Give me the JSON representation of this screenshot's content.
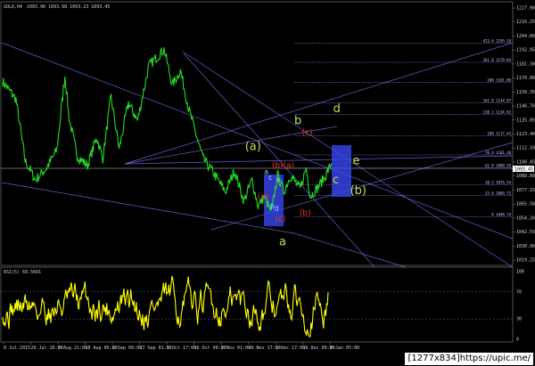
{
  "window": {
    "symbol_label": "GOLD,H4",
    "ohlc": "1093.90 1093.98 1093.23 1093.45",
    "indicator_label": "RSI(5) 69.5601"
  },
  "colors": {
    "background": "#000000",
    "price": "#22dd22",
    "rsi": "#ffff00",
    "trendline": "#7777ff",
    "fib": "#8888ff",
    "zone": "#3b4bff",
    "wave_green": "#b8e05a",
    "wave_red": "#ff3322",
    "wave_cyan": "#88ddff"
  },
  "chart_data": {
    "type": "line",
    "main": {
      "series_label": "GOLD,H4",
      "ylim": [
        1011.0,
        1227.0
      ],
      "price_ticks": [
        "1227.90",
        "1216.25",
        "1204.60",
        "1192.95",
        "1181.30",
        "1170.00",
        "1158.35",
        "1146.70",
        "1135.05",
        "1123.40",
        "1112.10",
        "1100.45",
        "1088.80",
        "1077.15",
        "1065.50",
        "1054.20",
        "1042.55",
        "1030.90",
        "1019.25"
      ],
      "current_price": "1093.45",
      "x_ticks": [
        "8 Jul 2015",
        "20 Jul 16:00",
        "3 Aug 21:00",
        "18 Aug 05:00",
        "2 Sep 09:00",
        "17 Sep 01:00",
        "1 Oct 17:00",
        "16 Oct 09:00",
        "2 Nov 01:00",
        "16 Nov 17:00",
        "1 Dec 17:00",
        "16 Dec 09:00",
        "4 Jan 05:00"
      ],
      "price_anchors": [
        [
          0,
          1163
        ],
        [
          1.3,
          1148
        ],
        [
          2.2,
          1096
        ],
        [
          3.2,
          1080
        ],
        [
          4.3,
          1090
        ],
        [
          5.3,
          1105
        ],
        [
          6.1,
          1168
        ],
        [
          6.5,
          1132
        ],
        [
          7.3,
          1100
        ],
        [
          8.3,
          1092
        ],
        [
          9.2,
          1116
        ],
        [
          9.8,
          1098
        ],
        [
          10.6,
          1150
        ],
        [
          11.4,
          1106
        ],
        [
          12.3,
          1145
        ],
        [
          13.2,
          1130
        ],
        [
          14.3,
          1176
        ],
        [
          15.8,
          1190
        ],
        [
          16.6,
          1160
        ],
        [
          17.4,
          1172
        ],
        [
          18.2,
          1140
        ],
        [
          19.6,
          1098
        ],
        [
          20.7,
          1085
        ],
        [
          21.8,
          1070
        ],
        [
          22.7,
          1088
        ],
        [
          23.6,
          1062
        ],
        [
          24.4,
          1080
        ],
        [
          25.0,
          1058
        ],
        [
          25.6,
          1066
        ],
        [
          26.3,
          1052
        ],
        [
          26.9,
          1084
        ],
        [
          27.5,
          1070
        ],
        [
          28.2,
          1084
        ],
        [
          29.1,
          1072
        ],
        [
          29.7,
          1090
        ],
        [
          30.1,
          1066
        ],
        [
          30.7,
          1072
        ],
        [
          31.5,
          1082
        ],
        [
          32.2,
          1094
        ]
      ],
      "wave_labels": [
        {
          "text": "(a)",
          "x": 24.5,
          "y": 1105,
          "color": "#b8e05a",
          "size": 13
        },
        {
          "text": "b",
          "x": 28.9,
          "y": 1127,
          "color": "#b8e05a",
          "size": 13
        },
        {
          "text": "d",
          "x": 32.7,
          "y": 1137,
          "color": "#b8e05a",
          "size": 13
        },
        {
          "text": "(c)",
          "x": 29.8,
          "y": 1118,
          "color": "#ff3322",
          "size": 9
        },
        {
          "text": "(b)",
          "x": 26.9,
          "y": 1090,
          "color": "#ff3322",
          "size": 9
        },
        {
          "text": "(a)",
          "x": 28.0,
          "y": 1090,
          "color": "#ff3322",
          "size": 9
        },
        {
          "text": "e",
          "x": 34.6,
          "y": 1093,
          "color": "#b8e05a",
          "size": 13
        },
        {
          "text": "c",
          "x": 32.6,
          "y": 1077,
          "color": "#b8e05a",
          "size": 13
        },
        {
          "text": "(b)",
          "x": 34.8,
          "y": 1068,
          "color": "#b8e05a",
          "size": 13
        },
        {
          "text": "(a)",
          "x": 25.5,
          "y": 1064,
          "color": "#ff3322",
          "size": 9
        },
        {
          "text": "a",
          "x": 25.8,
          "y": 1085,
          "color": "#88ddff",
          "size": 8
        },
        {
          "text": "b",
          "x": 26.4,
          "y": 1056,
          "color": "#88ddff",
          "size": 8
        },
        {
          "text": "c",
          "x": 26.2,
          "y": 1080,
          "color": "#88ddff",
          "size": 8
        },
        {
          "text": "d",
          "x": 26.8,
          "y": 1054,
          "color": "#88ddff",
          "size": 8
        },
        {
          "text": "e",
          "x": 27.0,
          "y": 1078,
          "color": "#88ddff",
          "size": 8
        },
        {
          "text": "(b)",
          "x": 29.6,
          "y": 1050,
          "color": "#ff3322",
          "size": 9
        },
        {
          "text": "(c)",
          "x": 27.2,
          "y": 1045,
          "color": "#ff3322",
          "size": 9
        },
        {
          "text": "a",
          "x": 27.4,
          "y": 1025,
          "color": "#b8e05a",
          "size": 13
        }
      ],
      "fib_levels": [
        {
          "price": 1195,
          "label": "423.6 1195.18"
        },
        {
          "price": 1179,
          "label": "261.8 1179.04"
        },
        {
          "price": 1162,
          "label": "200 1161.06"
        },
        {
          "price": 1145,
          "label": "161.8 1144.87"
        },
        {
          "price": 1135,
          "label": "138.2 1134.92"
        },
        {
          "price": 1117,
          "label": "100 1117.44"
        },
        {
          "price": 1101,
          "label": "76.4 1101.30"
        },
        {
          "price": 1090,
          "label": "61.8 1090.59"
        },
        {
          "price": 1076,
          "label": "38.2 1076.54"
        },
        {
          "price": 1067,
          "label": "23.6 1066.72"
        },
        {
          "price": 1049,
          "label": "0 1048.74"
        }
      ]
    },
    "rsi": {
      "ylim": [
        0,
        100
      ],
      "ticks": [
        "100",
        "70",
        "30",
        "0"
      ],
      "last": 69.5601
    }
  },
  "watermark": "[1277x834]https://upic.me/"
}
